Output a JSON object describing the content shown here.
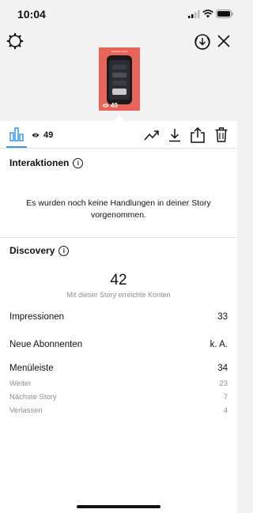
{
  "status_bar": {
    "time": "10:04"
  },
  "thumbnail": {
    "header": "instagram story",
    "views": "49"
  },
  "toolbar": {
    "views": "49"
  },
  "interactions": {
    "title": "Interaktionen",
    "empty_message": "Es wurden noch keine Handlungen in deiner Story vorgenommen."
  },
  "discovery": {
    "title": "Discovery",
    "reach_value": "42",
    "reach_label": "Mit dieser Story erreichte Konten",
    "impressions_label": "Impressionen",
    "impressions_value": "33",
    "followers_label": "Neue Abonnenten",
    "followers_value": "k. A.",
    "menu_label": "Menüleiste",
    "menu_value": "34",
    "menu_items": [
      {
        "label": "Weiter",
        "value": "23"
      },
      {
        "label": "Nächste Story",
        "value": "7"
      },
      {
        "label": "Verlassen",
        "value": "4"
      }
    ]
  },
  "icons": {
    "settings": "gear-icon",
    "save": "download-circle-icon",
    "close": "close-icon",
    "insights": "bar-chart-icon",
    "views": "eye-icon",
    "promote": "trending-up-icon",
    "download": "download-icon",
    "share": "share-icon",
    "delete": "trash-icon"
  },
  "colors": {
    "accent": "#3897f0",
    "story_bg": "#e8635a",
    "muted_text": "#8e8e8e"
  }
}
